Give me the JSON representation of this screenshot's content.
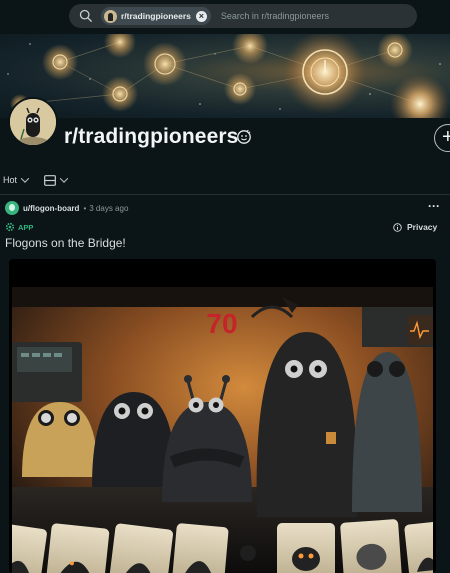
{
  "search": {
    "community_chip": "r/tradingpioneers",
    "placeholder": "Search in r/tradingpioneers",
    "search_icon": "search-icon",
    "clear_icon": "close-icon"
  },
  "header": {
    "title": "r/tradingpioneers",
    "mod_icon": "mod-shield-icon",
    "join_icon": "plus-icon"
  },
  "sort": {
    "label": "Hot",
    "view_icon": "card-view-icon"
  },
  "post": {
    "author": "u/flogon-board",
    "separator": "•",
    "time": "3 days ago",
    "app_badge": "APP",
    "privacy_label": "Privacy",
    "title": "Flogons on the Bridge!",
    "more_icon": "more-dots-icon",
    "game_score": "70"
  },
  "colors": {
    "background": "#0b1416",
    "search_bg": "#2a3236",
    "accent_green": "#36b37e",
    "score_red": "#c4242a"
  }
}
